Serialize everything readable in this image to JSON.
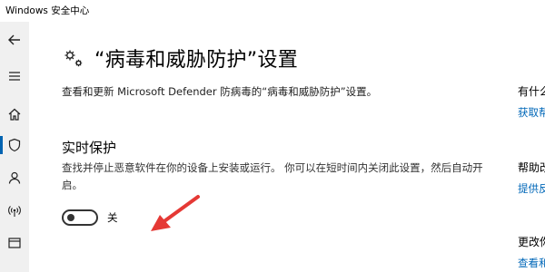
{
  "window": {
    "title": "Windows 安全中心"
  },
  "page": {
    "title": "“病毒和威胁防护”设置",
    "description": "查看和更新 Microsoft Defender 防病毒的“病毒和威胁防护”设置。"
  },
  "realtime": {
    "title": "实时保护",
    "description": "查找并停止恶意软件在你的设备上安装或运行。 你可以在短时间内关闭此设置，然后自动开启。",
    "toggle_state": "关",
    "toggle_on": false
  },
  "right": {
    "heading1": "有什么",
    "link1": "获取帮",
    "heading2": "帮助改",
    "link2": "提供反",
    "heading3": "更改你",
    "link3": "查看和"
  },
  "colors": {
    "accent": "#0063b1",
    "link": "#0067b8",
    "arrow": "#e53935"
  }
}
